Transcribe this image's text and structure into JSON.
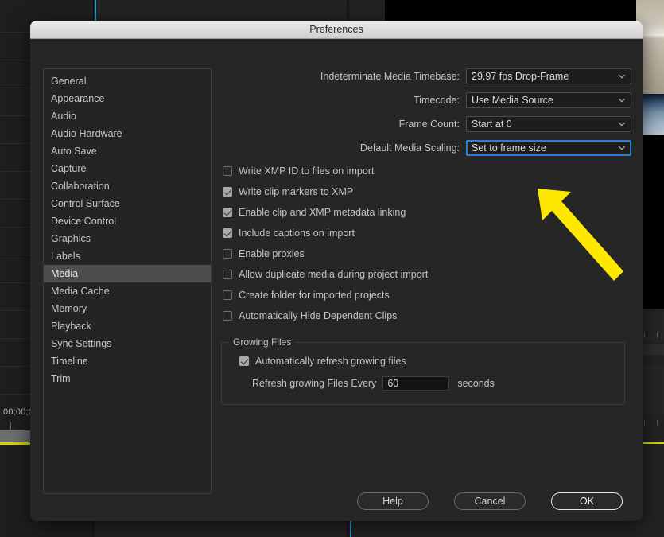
{
  "background": {
    "timecode": "00;00;0",
    "app": "premiere-pro-timeline"
  },
  "dialog": {
    "title": "Preferences",
    "sidebar": {
      "items": [
        {
          "label": "General",
          "selected": false
        },
        {
          "label": "Appearance",
          "selected": false
        },
        {
          "label": "Audio",
          "selected": false
        },
        {
          "label": "Audio Hardware",
          "selected": false
        },
        {
          "label": "Auto Save",
          "selected": false
        },
        {
          "label": "Capture",
          "selected": false
        },
        {
          "label": "Collaboration",
          "selected": false
        },
        {
          "label": "Control Surface",
          "selected": false
        },
        {
          "label": "Device Control",
          "selected": false
        },
        {
          "label": "Graphics",
          "selected": false
        },
        {
          "label": "Labels",
          "selected": false
        },
        {
          "label": "Media",
          "selected": true
        },
        {
          "label": "Media Cache",
          "selected": false
        },
        {
          "label": "Memory",
          "selected": false
        },
        {
          "label": "Playback",
          "selected": false
        },
        {
          "label": "Sync Settings",
          "selected": false
        },
        {
          "label": "Timeline",
          "selected": false
        },
        {
          "label": "Trim",
          "selected": false
        }
      ]
    },
    "media_pane": {
      "dropdowns": [
        {
          "label": "Indeterminate Media Timebase:",
          "value": "29.97 fps Drop-Frame",
          "focused": false
        },
        {
          "label": "Timecode:",
          "value": "Use Media Source",
          "focused": false
        },
        {
          "label": "Frame Count:",
          "value": "Start at 0",
          "focused": false
        },
        {
          "label": "Default Media Scaling:",
          "value": "Set to frame size",
          "focused": true
        }
      ],
      "checkboxes": [
        {
          "label": "Write XMP ID to files on import",
          "checked": false
        },
        {
          "label": "Write clip markers to XMP",
          "checked": true
        },
        {
          "label": "Enable clip and XMP metadata linking",
          "checked": true
        },
        {
          "label": "Include captions on import",
          "checked": true
        },
        {
          "label": "Enable proxies",
          "checked": false
        },
        {
          "label": "Allow duplicate media during project import",
          "checked": false
        },
        {
          "label": "Create folder for imported projects",
          "checked": false
        },
        {
          "label": "Automatically Hide Dependent Clips",
          "checked": false
        }
      ],
      "growing_files": {
        "legend": "Growing Files",
        "auto_refresh": {
          "label": "Automatically refresh growing files",
          "checked": true
        },
        "refresh_label": "Refresh growing Files Every",
        "refresh_value": "60",
        "refresh_unit": "seconds"
      }
    },
    "buttons": {
      "help": "Help",
      "cancel": "Cancel",
      "ok": "OK"
    }
  },
  "annotation": {
    "arrow_color": "#FFE800",
    "points_to": "Default Media Scaling dropdown"
  }
}
